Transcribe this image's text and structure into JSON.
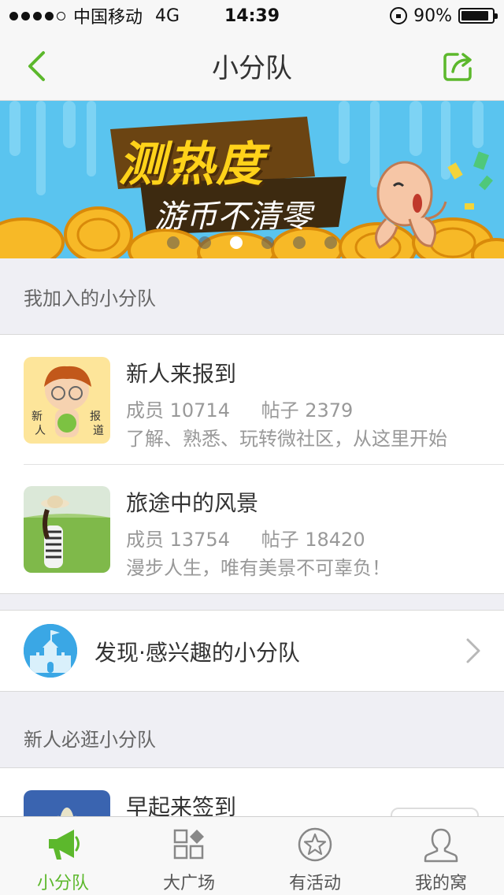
{
  "status_bar": {
    "carrier": "中国移动",
    "network": "4G",
    "time": "14:39",
    "battery": "90%",
    "battery_level": 0.9,
    "signal_bars": 4,
    "icons": [
      "signal-dots-icon",
      "rotation-lock-icon",
      "battery-icon"
    ]
  },
  "nav": {
    "title": "小分队",
    "back_icon": "back-chevron-icon",
    "share_icon": "share-icon"
  },
  "banner": {
    "title": "测热度",
    "subtitle": "游币不清零",
    "dot_count": 6,
    "active_dot": 2
  },
  "joined": {
    "header": "我加入的小分队",
    "groups": [
      {
        "name": "新人来报到",
        "members_label": "成员 10714",
        "posts_label": "帖子 2379",
        "description": "了解、熟悉、玩转微社区，从这里开始"
      },
      {
        "name": "旅途中的风景",
        "members_label": "成员 13754",
        "posts_label": "帖子 18420",
        "description": "漫步人生，唯有美景不可辜负！"
      }
    ]
  },
  "discover": {
    "label": "发现·感兴趣的小分队"
  },
  "recommended": {
    "header": "新人必逛小分队",
    "groups": [
      {
        "name": "早起来签到"
      }
    ]
  },
  "tab_bar": {
    "tabs": [
      {
        "label": "小分队",
        "icon": "megaphone-icon",
        "active": true
      },
      {
        "label": "大广场",
        "icon": "grid-icon",
        "active": false
      },
      {
        "label": "有活动",
        "icon": "star-icon",
        "active": false
      },
      {
        "label": "我的窝",
        "icon": "user-icon",
        "active": false
      }
    ]
  },
  "colors": {
    "accent": "#5cb82c",
    "banner_bg": "#5ac4ef",
    "banner_title": "#ffd21a"
  }
}
